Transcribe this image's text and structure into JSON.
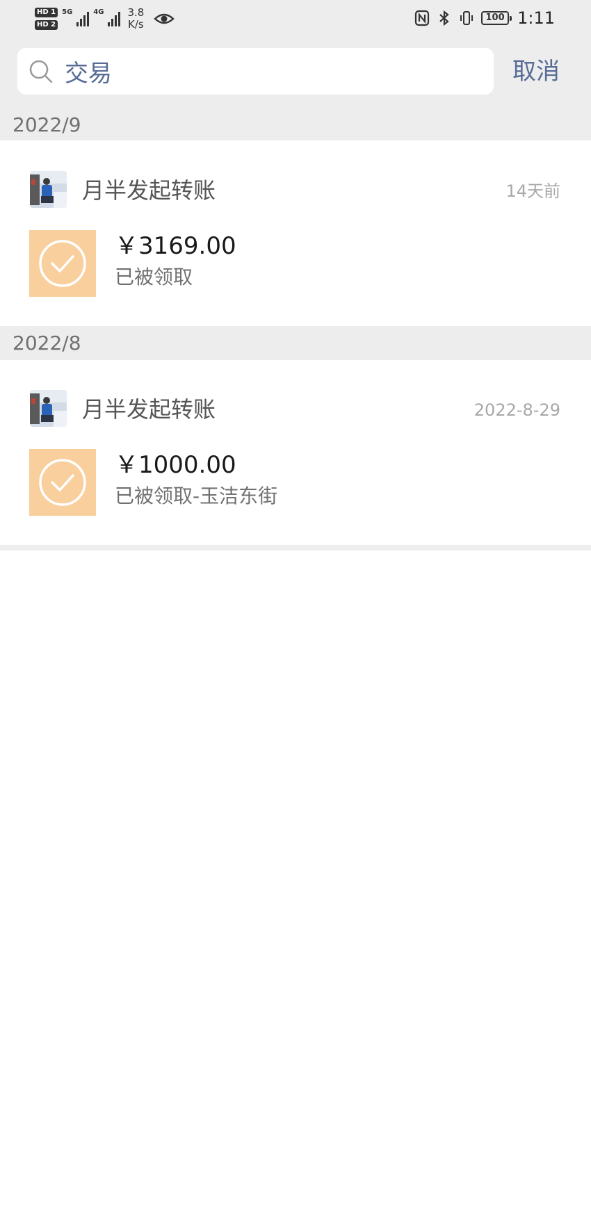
{
  "status_bar": {
    "hd1": "HD 1",
    "hd2": "HD 2",
    "net1": "5G",
    "net2": "4G",
    "speed_value": "3.8",
    "speed_unit": "K/s",
    "battery": "100",
    "time": "1:11"
  },
  "search": {
    "query": "交易",
    "cancel_label": "取消"
  },
  "sections": [
    {
      "date": "2022/9",
      "sender": "月半发起转账",
      "time": "14天前",
      "amount": "￥3169.00",
      "status": "已被领取"
    },
    {
      "date": "2022/8",
      "sender": "月半发起转账",
      "time": "2022-8-29",
      "amount": "￥1000.00",
      "status": "已被领取-玉洁东街"
    }
  ],
  "colors": {
    "link": "#576b95",
    "transfer_icon_bg": "#f8cf9d",
    "page_gray": "#ededed"
  }
}
